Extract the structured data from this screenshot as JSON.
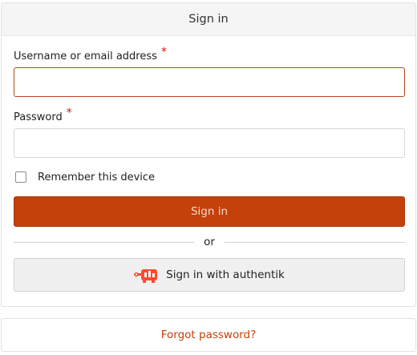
{
  "header": {
    "title": "Sign in"
  },
  "form": {
    "username": {
      "label": "Username or email address",
      "required_mark": "*",
      "value": "",
      "placeholder": ""
    },
    "password": {
      "label": "Password",
      "required_mark": "*",
      "value": "",
      "placeholder": ""
    },
    "remember": {
      "label": "Remember this device",
      "checked": false
    },
    "submit_label": "Sign in",
    "divider_text": "or",
    "source_button": {
      "label": "Sign in with authentik",
      "icon": "authentik-logo-icon"
    }
  },
  "footer": {
    "forgot_label": "Forgot password?"
  },
  "colors": {
    "accent": "#c4410b",
    "required": "#c9190b"
  }
}
